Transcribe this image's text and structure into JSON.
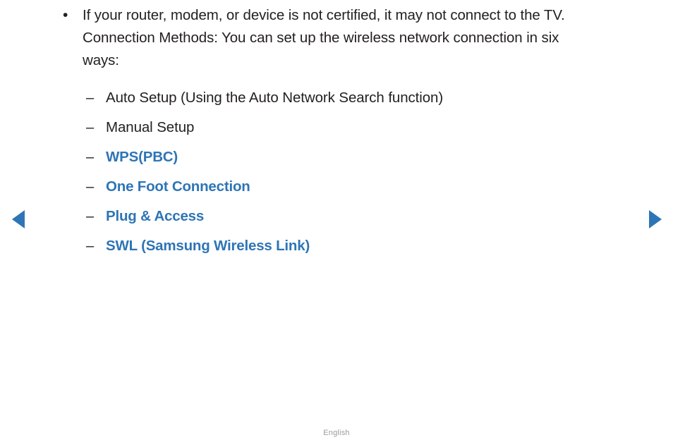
{
  "page": {
    "note": {
      "marker": "•",
      "text": "If your router, modem, or device is not certified, it may not connect to the TV.\nConnection Methods: You can set up the wireless network connection in six\nways:"
    },
    "methods": {
      "marker": "–",
      "items": [
        {
          "label": "Auto Setup (Using the Auto Network Search function)",
          "is_link": false
        },
        {
          "label": "Manual Setup",
          "is_link": false
        },
        {
          "label": "WPS(PBC)",
          "is_link": true
        },
        {
          "label": "One Foot Connection",
          "is_link": true
        },
        {
          "label": "Plug & Access",
          "is_link": true
        },
        {
          "label": "SWL (Samsung Wireless Link)",
          "is_link": true
        }
      ]
    }
  },
  "navigation": {
    "prev_icon": "triangle-left-icon",
    "next_icon": "triangle-right-icon"
  },
  "footer": {
    "language": "English"
  },
  "colors": {
    "link": "#2e75b6",
    "text": "#231f20",
    "footer": "#9b9b9b",
    "background": "#ffffff"
  }
}
